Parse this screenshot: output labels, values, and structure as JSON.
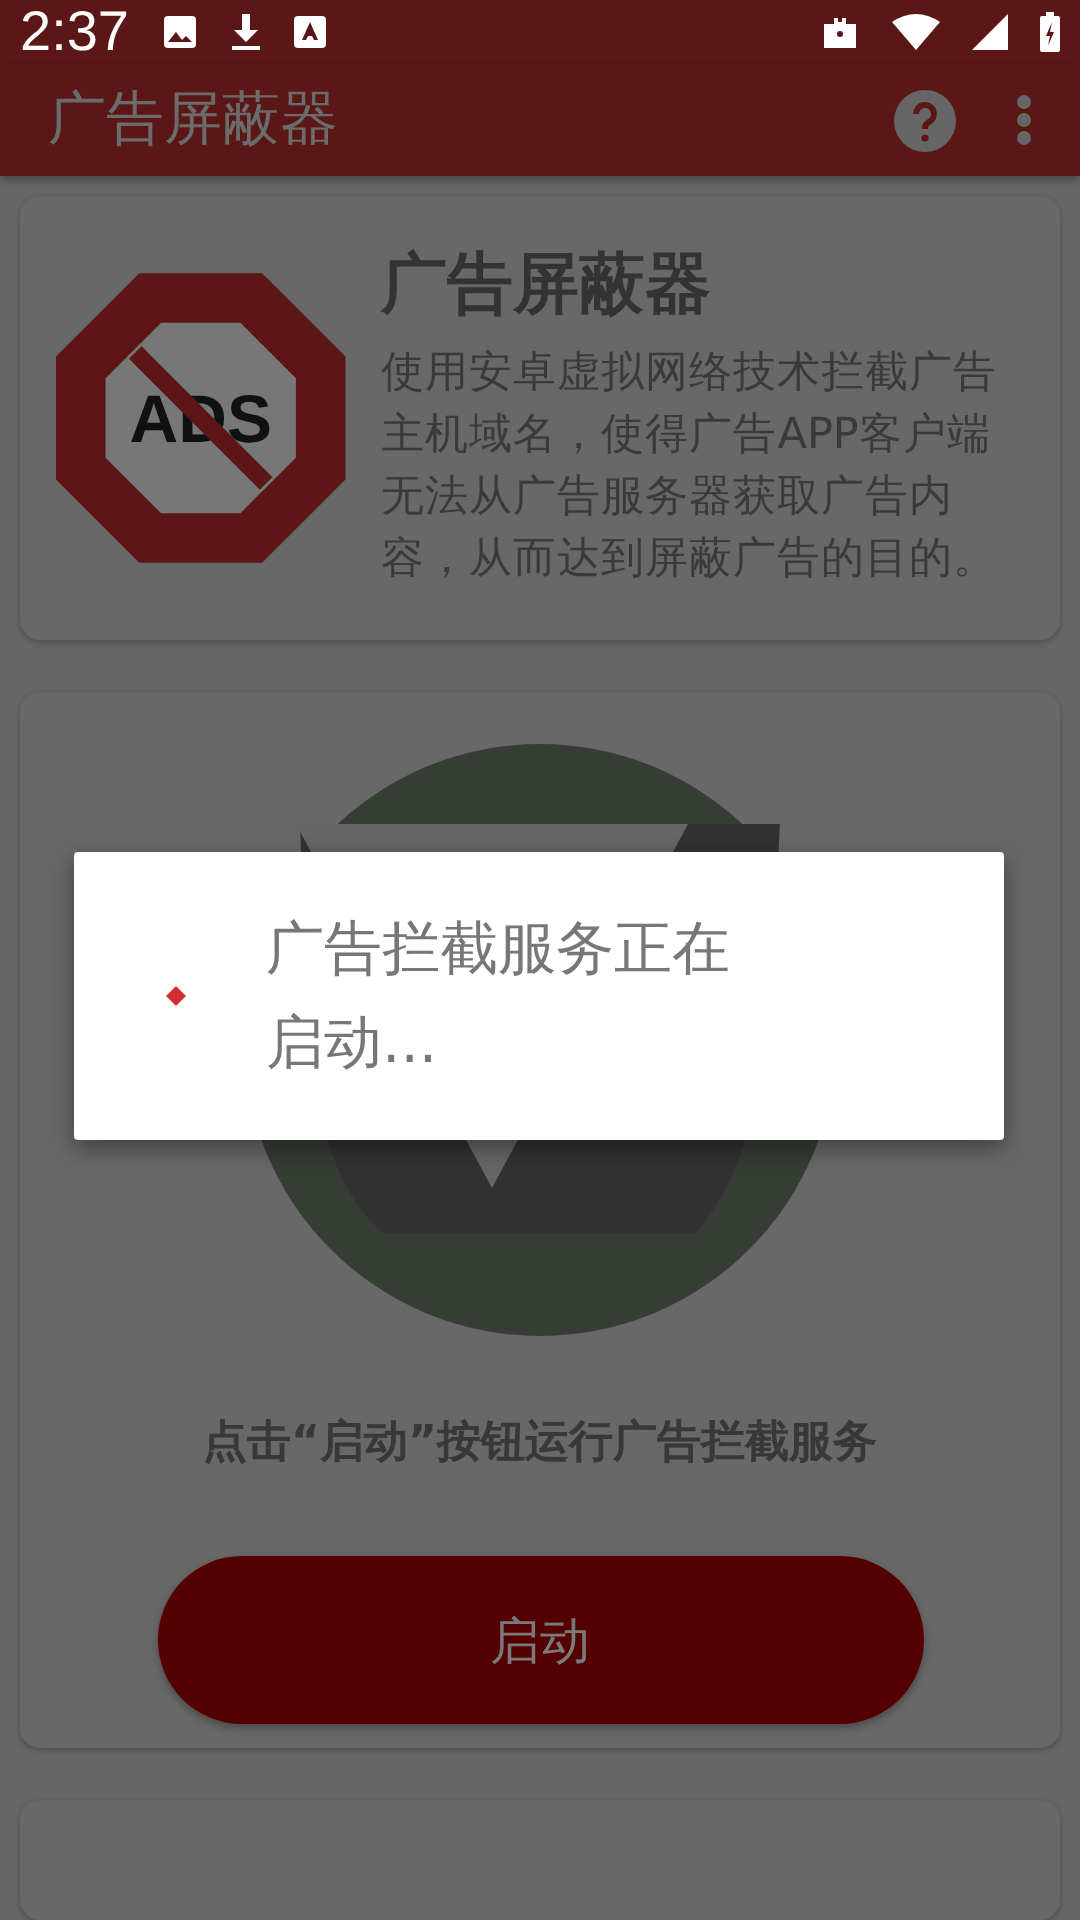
{
  "status_bar": {
    "time": "2:37"
  },
  "app_bar": {
    "title": "广告屏蔽器"
  },
  "intro_card": {
    "logo_text": "ADS",
    "title": "广告屏蔽器",
    "description": "使用安卓虚拟网络技术拦截广告主机域名，使得广告APP客户端无法从广告服务器获取广告内容，从而达到屏蔽广告的目的。"
  },
  "service_card": {
    "instruction": "点击“启动”按钮运行广告拦截服务",
    "button": "启动"
  },
  "dialog": {
    "message": "广告拦截服务正在启动..."
  }
}
